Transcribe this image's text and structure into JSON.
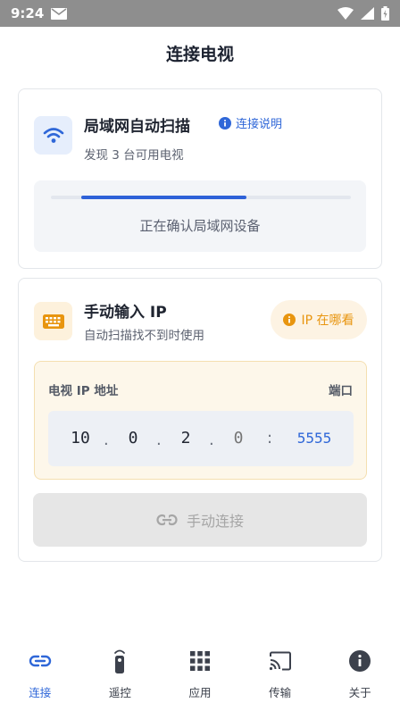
{
  "status_bar": {
    "time": "9:24"
  },
  "page": {
    "title": "连接电视"
  },
  "scan_card": {
    "title": "局域网自动扫描",
    "help_label": "连接说明",
    "subtitle": "发现 3 台可用电视",
    "progress": 0.55,
    "status_text": "正在确认局域网设备"
  },
  "manual_card": {
    "title": "手动输入 IP",
    "subtitle": "自动扫描找不到时使用",
    "ip_help_label": "IP 在哪看",
    "ip_label": "电视 IP 地址",
    "port_label": "端口",
    "octets": [
      "10",
      "0",
      "2",
      ""
    ],
    "octet_placeholder": "0",
    "port_value": "5555",
    "connect_label": "手动连接"
  },
  "colors": {
    "accent": "#2f67d8",
    "warning": "#e8950f",
    "disabled": "#e6e6e6"
  },
  "nav": {
    "items": [
      {
        "label": "连接",
        "icon": "link-icon",
        "active": true
      },
      {
        "label": "遥控",
        "icon": "remote-icon",
        "active": false
      },
      {
        "label": "应用",
        "icon": "grid-icon",
        "active": false
      },
      {
        "label": "传输",
        "icon": "cast-icon",
        "active": false
      },
      {
        "label": "关于",
        "icon": "info-icon",
        "active": false
      }
    ]
  }
}
